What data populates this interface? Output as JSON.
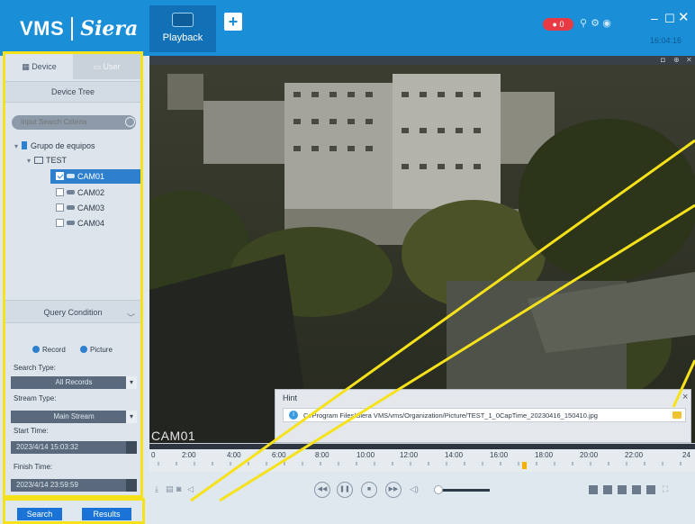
{
  "app": {
    "logo_text": "VMS",
    "brand_text": "Siera",
    "active_tab": "Playback",
    "add_tab_symbol": "+",
    "alarm_count": "0",
    "clock": "16:04:16"
  },
  "left_panel": {
    "tabs": [
      "Device",
      "User"
    ],
    "device_tree_title": "Device Tree",
    "search_placeholder": "Input Search Criteria",
    "tree": {
      "group": "Grupo de equipos",
      "folder": "TEST",
      "cameras": [
        {
          "label": "CAM01",
          "checked": true,
          "selected": true
        },
        {
          "label": "CAM02",
          "checked": false,
          "selected": false
        },
        {
          "label": "CAM03",
          "checked": false,
          "selected": false
        },
        {
          "label": "CAM04",
          "checked": false,
          "selected": false
        }
      ]
    },
    "query_condition_title": "Query Condition",
    "record_label": "Record",
    "picture_label": "Picture",
    "search_type_label": "Search Type:",
    "search_type_value": "All Records",
    "stream_type_label": "Stream Type:",
    "stream_type_value": "Main Stream",
    "start_time_label": "Start Time:",
    "start_time_value": "2023/4/14 15:03:32",
    "finish_time_label": "Finish Time:",
    "finish_time_value": "2023/4/14 23:59:59",
    "search_button": "Search",
    "results_button": "Results"
  },
  "video": {
    "camera_label": "CAM01"
  },
  "hint": {
    "title": "Hint",
    "close": "×",
    "path": "C:/Program Files/Siera VMS/vms/Organization/Picture/TEST_1_0CapTime_20230416_150410.jpg"
  },
  "timeline": {
    "ticks": [
      "0",
      "2:00",
      "4:00",
      "6:00",
      "8:00",
      "10:00",
      "12:00",
      "14:00",
      "16:00",
      "18:00",
      "20:00",
      "22:00",
      "24"
    ]
  },
  "colors": {
    "topbar": "#1a8fd8",
    "highlight": "#f6e21a",
    "selection": "#2f7fcf",
    "button": "#1a73d6"
  }
}
